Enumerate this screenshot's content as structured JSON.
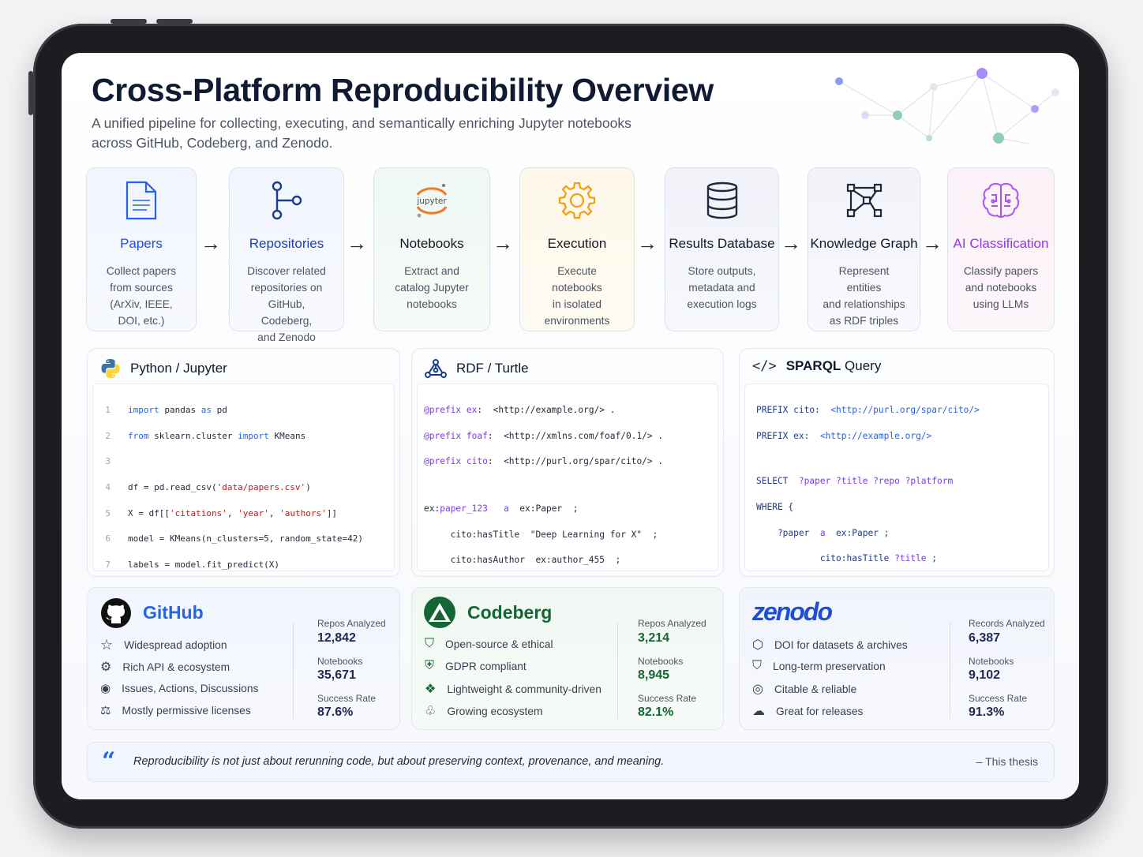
{
  "header": {
    "title": "Cross-Platform Reproducibility Overview",
    "subtitle_line1": "A unified pipeline for collecting, executing, and semantically enriching Jupyter notebooks",
    "subtitle_line2": "across GitHub, Codeberg, and Zenodo."
  },
  "pipeline": [
    {
      "title": "Papers",
      "desc": [
        "Collect papers",
        "from sources",
        "(ArXiv, IEEE,",
        "DOI, etc.)"
      ],
      "icon": "document-icon",
      "color": "#2563eb"
    },
    {
      "title": "Repositories",
      "desc": [
        "Discover related",
        "repositories on",
        "GitHub, Codeberg,",
        "and Zenodo"
      ],
      "icon": "git-branch-icon",
      "color": "#1e40af"
    },
    {
      "title": "Notebooks",
      "desc": [
        "Extract and",
        "catalog Jupyter",
        "notebooks"
      ],
      "icon": "jupyter-icon",
      "icon_text": "jupyter",
      "color": "#111827"
    },
    {
      "title": "Execution",
      "desc": [
        "Execute notebooks",
        "in isolated",
        "environments"
      ],
      "icon": "gear-icon",
      "color": "#111827"
    },
    {
      "title": "Results Database",
      "desc": [
        "Store outputs,",
        "metadata and",
        "execution logs"
      ],
      "icon": "database-icon",
      "color": "#111827"
    },
    {
      "title": "Knowledge Graph",
      "desc": [
        "Represent entities",
        "and relationships",
        "as RDF triples"
      ],
      "icon": "graph-icon",
      "color": "#111827"
    },
    {
      "title": "AI Classification",
      "desc": [
        "Classify papers",
        "and notebooks",
        "using LLMs"
      ],
      "icon": "brain-icon",
      "color": "#9333ea"
    }
  ],
  "panels": {
    "python": {
      "title": "Python / Jupyter"
    },
    "rdf": {
      "title": "RDF / Turtle"
    },
    "sparql": {
      "title_a": "SPARQL",
      "title_b": "Query"
    }
  },
  "platforms": {
    "github": {
      "name": "GitHub",
      "features": [
        "Widespread adoption",
        "Rich API & ecosystem",
        "Issues, Actions, Discussions",
        "Mostly permissive licenses"
      ],
      "stats": [
        {
          "label": "Repos Analyzed",
          "value": "12,842"
        },
        {
          "label": "Notebooks",
          "value": "35,671"
        },
        {
          "label": "Success Rate",
          "value": "87.6%"
        }
      ]
    },
    "codeberg": {
      "name": "Codeberg",
      "features": [
        "Open-source & ethical",
        "GDPR compliant",
        "Lightweight & community-driven",
        "Growing ecosystem"
      ],
      "stats": [
        {
          "label": "Repos Analyzed",
          "value": "3,214"
        },
        {
          "label": "Notebooks",
          "value": "8,945"
        },
        {
          "label": "Success Rate",
          "value": "82.1%"
        }
      ]
    },
    "zenodo": {
      "name": "zenodo",
      "features": [
        "DOI for datasets & archives",
        "Long-term preservation",
        "Citable & reliable",
        "Great for releases"
      ],
      "stats": [
        {
          "label": "Records Analyzed",
          "value": "6,387"
        },
        {
          "label": "Notebooks",
          "value": "9,102"
        },
        {
          "label": "Success Rate",
          "value": "91.3%"
        }
      ]
    }
  },
  "quote": {
    "mark": "“",
    "text": "Reproducibility is not just about rerunning code, but about preserving context, provenance, and meaning.",
    "attribution": "– This thesis"
  },
  "colors": {
    "github": "#2563eb",
    "codeberg": "#166534",
    "zenodo": "#1d4ed8",
    "accent": "#2563eb"
  }
}
